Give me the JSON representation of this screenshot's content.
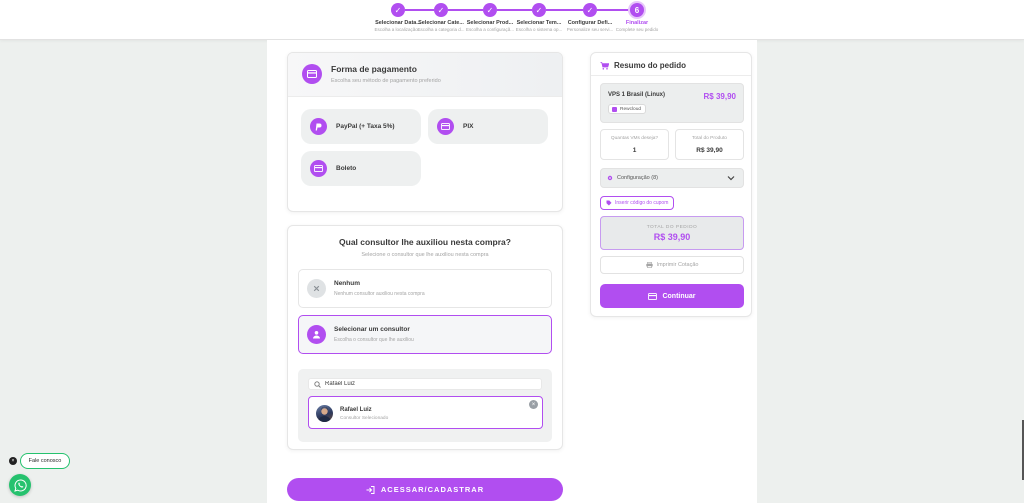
{
  "stepper": {
    "steps": [
      {
        "title": "Selecionar Data...",
        "sub": "Escolha a localização..."
      },
      {
        "title": "Selecionar Cate...",
        "sub": "Escolha a categoria d..."
      },
      {
        "title": "Selecionar Prod...",
        "sub": "Escolha a configuraçã..."
      },
      {
        "title": "Selecionar Tem...",
        "sub": "Escolha o sistema op..."
      },
      {
        "title": "Configurar Defi...",
        "sub": "Personalize seu servi..."
      },
      {
        "title": "Finalizar",
        "sub": "Complete seu pedido",
        "number": "6"
      }
    ],
    "check_glyph": "✓"
  },
  "payment": {
    "title": "Forma de pagamento",
    "subtitle": "Escolha seu método de pagamento preferido",
    "options": [
      {
        "label": "PayPal (+ Taxa 5%)"
      },
      {
        "label": "PIX"
      },
      {
        "label": "Boleto"
      }
    ]
  },
  "consultor": {
    "title": "Qual consultor lhe auxiliou nesta compra?",
    "subtitle": "Selecione o consultor que lhe auxiliou nesta compra",
    "options": [
      {
        "title": "Nenhum",
        "sub": "Nenhum consultor auxiliou nesta compra"
      },
      {
        "title": "Selecionar um consultor",
        "sub": "Escolha o consultor que lhe auxiliou"
      }
    ],
    "search_value": "Rafael Luiz",
    "result": {
      "name": "Rafael Luiz",
      "sub": "Consultor Selecionado"
    }
  },
  "access_button": "ACESSAR/CADASTRAR",
  "resumo": {
    "title": "Resumo do pedido",
    "product": {
      "name": "VPS 1 Brasil (Linux)",
      "price": "R$ 39,90",
      "badge": "Rewcloud"
    },
    "quantity_label": "Quantas VMs deseja?",
    "quantity_value": "1",
    "total_product_label": "Total do Produto",
    "total_product_value": "R$ 39,90",
    "config_label": "Configuração (8)",
    "coupon_label": "Inserir código do cupom",
    "total_label": "TOTAL DO PEDIDO",
    "total_value": "R$ 39,90",
    "print_label": "Imprimir Cotação",
    "continue_label": "Continuar"
  },
  "chat": {
    "label": "Fale conosco",
    "close": "×"
  },
  "colors": {
    "accent": "#b14ef0",
    "whatsapp": "#25c26e"
  }
}
